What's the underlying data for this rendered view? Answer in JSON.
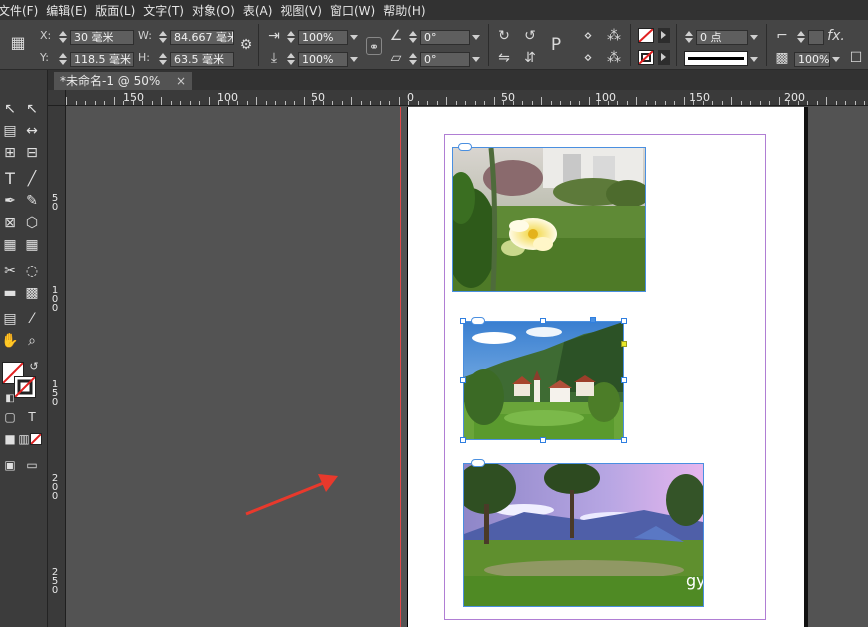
{
  "menu": [
    "文件(F)",
    "编辑(E)",
    "版面(L)",
    "文字(T)",
    "对象(O)",
    "表(A)",
    "视图(V)",
    "窗口(W)",
    "帮助(H)"
  ],
  "control": {
    "x_label": "X:",
    "x_value": "30 毫米",
    "y_label": "Y:",
    "y_value": "118.5 毫米",
    "w_label": "W:",
    "w_value": "84.667 毫米",
    "h_label": "H:",
    "h_value": "63.5 毫米",
    "scale_x": "100%",
    "scale_y": "100%",
    "rotate": "0°",
    "shear": "0°",
    "stroke_weight": "0 点",
    "opacity": "100%",
    "fx_label": "fx."
  },
  "tab": {
    "title": "*未命名-1 @ 50%",
    "close": "×"
  },
  "ruler_top": [
    "150",
    "100",
    "50",
    "0",
    "50",
    "100",
    "150",
    "200"
  ],
  "ruler_left": [
    "5\n0",
    "1\n0\n0",
    "1\n5\n0",
    "2\n0\n0",
    "2\n5\n0"
  ],
  "watermark": "gy",
  "images": [
    {
      "name": "flower-photo",
      "desc": "flower"
    },
    {
      "name": "village-photo",
      "desc": "village"
    },
    {
      "name": "park-photo",
      "desc": "park"
    }
  ],
  "colors": {
    "selection": "#4a8fe0",
    "margin": "#b07ed4",
    "arrow": "#e8392c"
  }
}
